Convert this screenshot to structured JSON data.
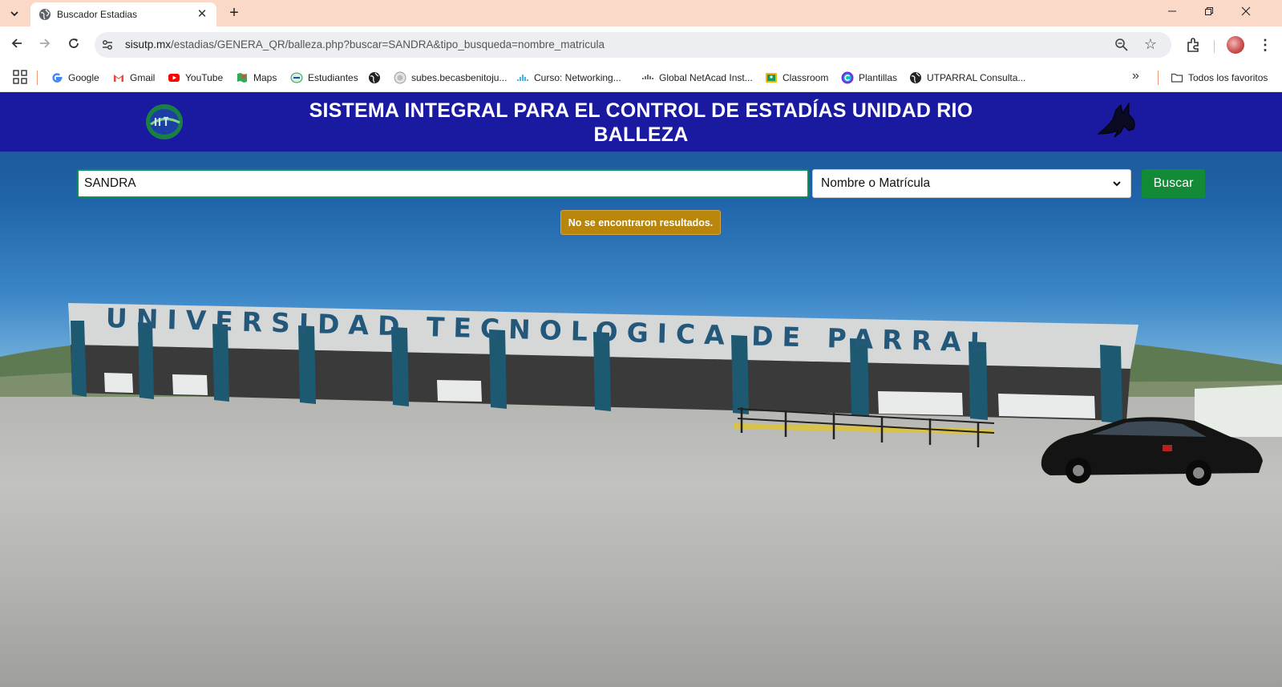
{
  "browser": {
    "tab_title": "Buscador Estadias",
    "url_host": "sisutp.mx",
    "url_path": "/estadias/GENERA_QR/balleza.php?buscar=SANDRA&tipo_busqueda=nombre_matricula"
  },
  "bookmarks": {
    "items": [
      {
        "label": "Google",
        "icon": "google-icon"
      },
      {
        "label": "Gmail",
        "icon": "gmail-icon"
      },
      {
        "label": "YouTube",
        "icon": "youtube-icon"
      },
      {
        "label": "Maps",
        "icon": "maps-icon"
      },
      {
        "label": "Estudiantes",
        "icon": "utp-icon"
      },
      {
        "label": "",
        "icon": "globe-icon"
      },
      {
        "label": "subes.becasbenitoju...",
        "icon": "seal-icon"
      },
      {
        "label": "Curso: Networking...",
        "icon": "cisco-icon"
      },
      {
        "label": "Global NetAcad Inst...",
        "icon": "cisco-icon"
      },
      {
        "label": "Classroom",
        "icon": "classroom-icon"
      },
      {
        "label": "Plantillas",
        "icon": "canva-icon"
      },
      {
        "label": "UTPARRAL Consulta...",
        "icon": "globe-icon"
      }
    ],
    "all_label": "Todos los favoritos"
  },
  "header": {
    "title": "SISTEMA INTEGRAL PARA EL CONTROL DE ESTADÍAS UNIDAD RIO BALLEZA"
  },
  "search": {
    "value": "SANDRA",
    "type_selected": "Nombre o Matrícula",
    "button_label": "Buscar"
  },
  "alert": {
    "message": "No se encontraron resultados."
  },
  "background": {
    "sign_text": "UNIVERSIDAD TECNOLOGICA DE PARRAL"
  },
  "colors": {
    "header_bg": "#1a1aa0",
    "button_bg": "#128a36",
    "alert_bg": "#b8860b",
    "tabbar_bg": "#fbd9c8"
  }
}
